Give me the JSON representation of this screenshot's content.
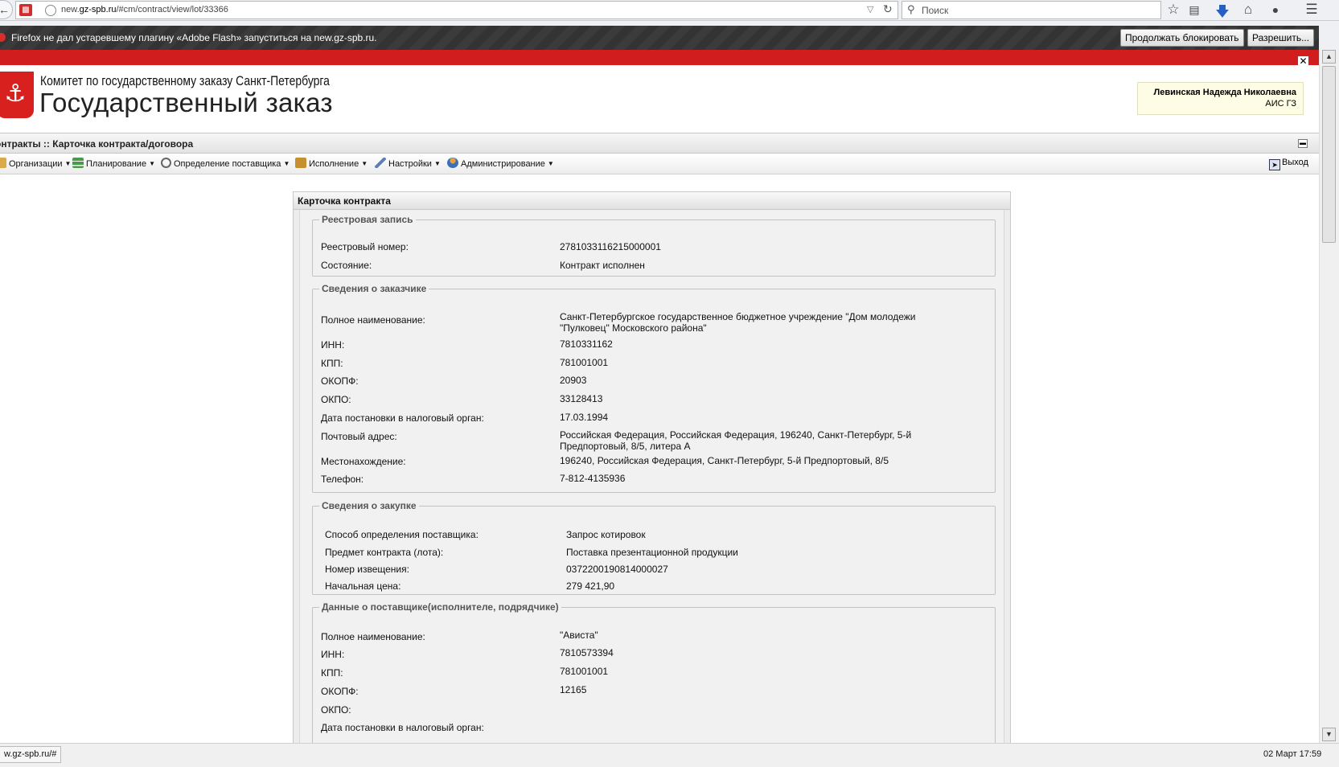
{
  "browser": {
    "url_prefix": "new.",
    "url_domain": "gz-spb.ru",
    "url_path": "/#cm/contract/view/lot/33366",
    "search_placeholder": "Поиск"
  },
  "flash_notice": {
    "text": "Firefox не дал устаревшему плагину «Adobe Flash» запуститься на new.gz-spb.ru.",
    "continue_blocking": "Продолжать блокировать",
    "allow": "Разрешить..."
  },
  "header": {
    "org_name": "Комитет по государственному заказу Санкт-Петербурга",
    "app_name": "Государственный заказ",
    "user_name": "Левинская Надежда Николаевна",
    "user_role": "АИС ГЗ"
  },
  "breadcrumb": "онтракты :: Карточка контракта/договора",
  "menu": [
    {
      "label": "Организации"
    },
    {
      "label": "Планирование"
    },
    {
      "label": "Определение поставщика"
    },
    {
      "label": "Исполнение"
    },
    {
      "label": "Настройки"
    },
    {
      "label": "Администрирование"
    }
  ],
  "exit_label": "Выход",
  "panel_title": "Карточка контракта",
  "registry": {
    "legend": "Реестровая запись",
    "rows": [
      {
        "label": "Реестровый номер:",
        "value": "2781033116215000001"
      },
      {
        "label": "Состояние:",
        "value": "Контракт исполнен"
      }
    ]
  },
  "customer": {
    "legend": "Сведения о заказчике",
    "rows": [
      {
        "label": "Полное наименование:",
        "value": "Санкт-Петербургское государственное бюджетное учреждение \"Дом молодежи \"Пулковец\" Московского района\""
      },
      {
        "label": "ИНН:",
        "value": "7810331162"
      },
      {
        "label": "КПП:",
        "value": "781001001"
      },
      {
        "label": "ОКОПФ:",
        "value": "20903"
      },
      {
        "label": "ОКПО:",
        "value": "33128413"
      },
      {
        "label": "Дата постановки в налоговый орган:",
        "value": "17.03.1994"
      },
      {
        "label": "Почтовый адрес:",
        "value": "Российская Федерация, Российская Федерация, 196240, Санкт-Петербург, 5-й Предпортовый, 8/5, литера А"
      },
      {
        "label": "Местонахождение:",
        "value": "196240, Российская Федерация, Санкт-Петербург, 5-й Предпортовый, 8/5"
      },
      {
        "label": "Телефон:",
        "value": "7-812-4135936"
      }
    ]
  },
  "purchase": {
    "legend": "Сведения о закупке",
    "rows": [
      {
        "label": "Способ определения поставщика:",
        "value": "Запрос котировок"
      },
      {
        "label": "Предмет контракта (лота):",
        "value": "Поставка презентационной продукции"
      },
      {
        "label": "Номер извещения:",
        "value": "0372200190814000027"
      },
      {
        "label": "Начальная цена:",
        "value": "279 421,90"
      }
    ]
  },
  "supplier": {
    "legend": "Данные о поставщике(исполнителе, подрядчике)",
    "rows": [
      {
        "label": "Полное наименование:",
        "value": "\"Ависта\""
      },
      {
        "label": "ИНН:",
        "value": "7810573394"
      },
      {
        "label": "КПП:",
        "value": "781001001"
      },
      {
        "label": "ОКОПФ:",
        "value": "12165"
      },
      {
        "label": "ОКПО:",
        "value": ""
      },
      {
        "label": "Дата постановки в налоговый орган:",
        "value": ""
      }
    ]
  },
  "status": {
    "url": "w.gz-spb.ru/#",
    "datetime": "02 Март 17:59"
  }
}
